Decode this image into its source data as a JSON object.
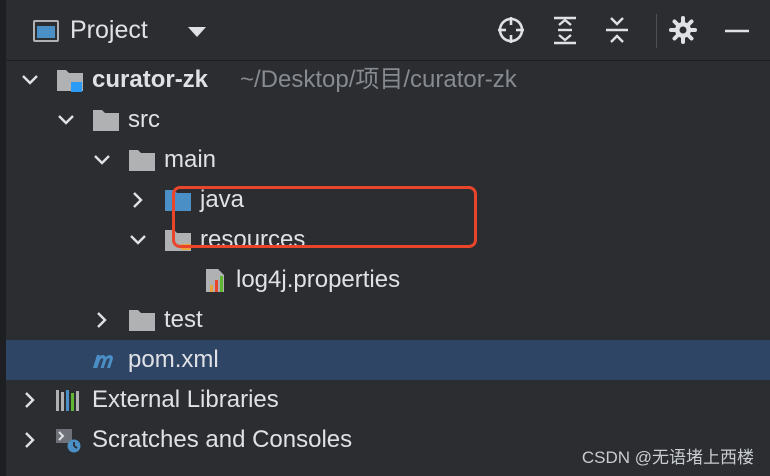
{
  "header": {
    "title": "Project",
    "icons": [
      "locate-icon",
      "expand-all-icon",
      "collapse-all-icon",
      "gear-icon",
      "minimize-icon"
    ]
  },
  "tree": {
    "root": {
      "name": "curator-zk",
      "path": "~/Desktop/项目/curator-zk"
    },
    "src": "src",
    "main": "main",
    "java": "java",
    "resources": "resources",
    "log4j": "log4j.properties",
    "test": "test",
    "pom": "pom.xml",
    "external_libraries": "External Libraries",
    "scratches": "Scratches and Consoles"
  },
  "watermark": "CSDN @无语堵上西楼",
  "colors": {
    "background": "#2b2d30",
    "selection": "#2f4566",
    "highlight": "#e8452b",
    "folder_blue": "#4a8fc5",
    "folder_gray": "#afb1b3",
    "pom_blue": "#4a8fc5"
  }
}
